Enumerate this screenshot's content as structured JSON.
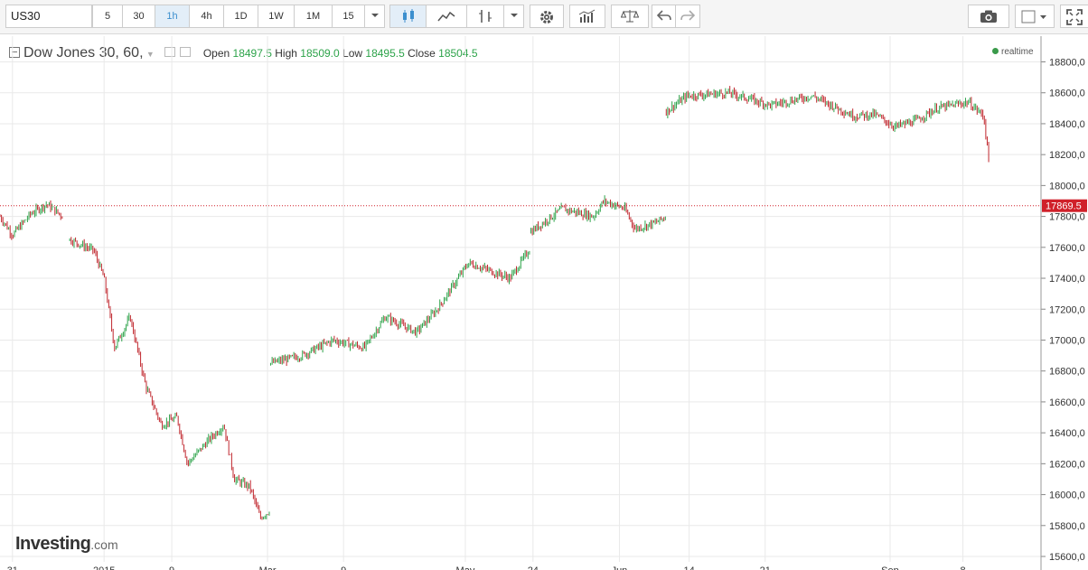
{
  "toolbar": {
    "symbol": "US30",
    "intervals": [
      "5",
      "30",
      "1h",
      "4h",
      "1D",
      "1W",
      "1M",
      "15"
    ],
    "active_interval": "1h"
  },
  "legend": {
    "name": "Dow Jones 30, 60,",
    "open_label": "Open",
    "open": "18497.5",
    "high_label": "High",
    "high": "18509.0",
    "low_label": "Low",
    "low": "18495.5",
    "close_label": "Close",
    "close": "18504.5"
  },
  "realtime_label": "realtime",
  "logo": {
    "main": "Investing",
    "sub": ".com"
  },
  "colors": {
    "up": "#2da34a",
    "down": "#c0262d",
    "price_tag": "#d0202a",
    "accent": "#3c8fce"
  },
  "chart_data": {
    "type": "candlestick",
    "y_ticks": [
      "18800,0",
      "18600,0",
      "18400,0",
      "18200,0",
      "18000,0",
      "17800,0",
      "17600,0",
      "17400,0",
      "17200,0",
      "17000,0",
      "16800,0",
      "16600,0",
      "16400,0",
      "16200,0",
      "16000,0",
      "15800,0",
      "15600,0"
    ],
    "ylim": [
      15600,
      18800
    ],
    "x_ticks": [
      "31",
      "2015",
      "9",
      "Mar",
      "9",
      "May",
      "24",
      "Jun",
      "14",
      "21",
      "Sep",
      "8"
    ],
    "current_price": "17869.5",
    "segments": [
      {
        "from": 0.0,
        "to": 0.06,
        "path": [
          [
            0.0,
            17800
          ],
          [
            0.012,
            17680
          ],
          [
            0.03,
            17820
          ],
          [
            0.045,
            17880
          ],
          [
            0.06,
            17800
          ]
        ]
      },
      {
        "from": 0.067,
        "to": 0.26,
        "path": [
          [
            0.067,
            17650
          ],
          [
            0.09,
            17580
          ],
          [
            0.1,
            17400
          ],
          [
            0.11,
            16950
          ],
          [
            0.125,
            17150
          ],
          [
            0.14,
            16700
          ],
          [
            0.155,
            16450
          ],
          [
            0.17,
            16500
          ],
          [
            0.18,
            16200
          ],
          [
            0.2,
            16350
          ],
          [
            0.215,
            16450
          ],
          [
            0.225,
            16100
          ],
          [
            0.24,
            16050
          ],
          [
            0.25,
            15850
          ],
          [
            0.26,
            15900
          ]
        ]
      },
      {
        "from": 0.26,
        "to": 0.51,
        "path": [
          [
            0.26,
            16850
          ],
          [
            0.29,
            16900
          ],
          [
            0.32,
            17000
          ],
          [
            0.35,
            16950
          ],
          [
            0.37,
            17150
          ],
          [
            0.4,
            17050
          ],
          [
            0.42,
            17200
          ],
          [
            0.45,
            17500
          ],
          [
            0.47,
            17450
          ],
          [
            0.49,
            17400
          ],
          [
            0.51,
            17600
          ]
        ]
      },
      {
        "from": 0.51,
        "to": 0.64,
        "path": [
          [
            0.51,
            17700
          ],
          [
            0.54,
            17850
          ],
          [
            0.57,
            17800
          ],
          [
            0.58,
            17900
          ],
          [
            0.6,
            17850
          ],
          [
            0.61,
            17720
          ],
          [
            0.63,
            17760
          ],
          [
            0.64,
            17800
          ]
        ]
      },
      {
        "from": 0.64,
        "to": 0.95,
        "path": [
          [
            0.64,
            18480
          ],
          [
            0.66,
            18580
          ],
          [
            0.7,
            18600
          ],
          [
            0.74,
            18520
          ],
          [
            0.78,
            18580
          ],
          [
            0.82,
            18450
          ],
          [
            0.84,
            18460
          ],
          [
            0.86,
            18380
          ],
          [
            0.88,
            18420
          ],
          [
            0.9,
            18500
          ],
          [
            0.93,
            18540
          ],
          [
            0.945,
            18450
          ],
          [
            0.95,
            18150
          ],
          [
            0.955,
            17869
          ]
        ]
      }
    ]
  }
}
